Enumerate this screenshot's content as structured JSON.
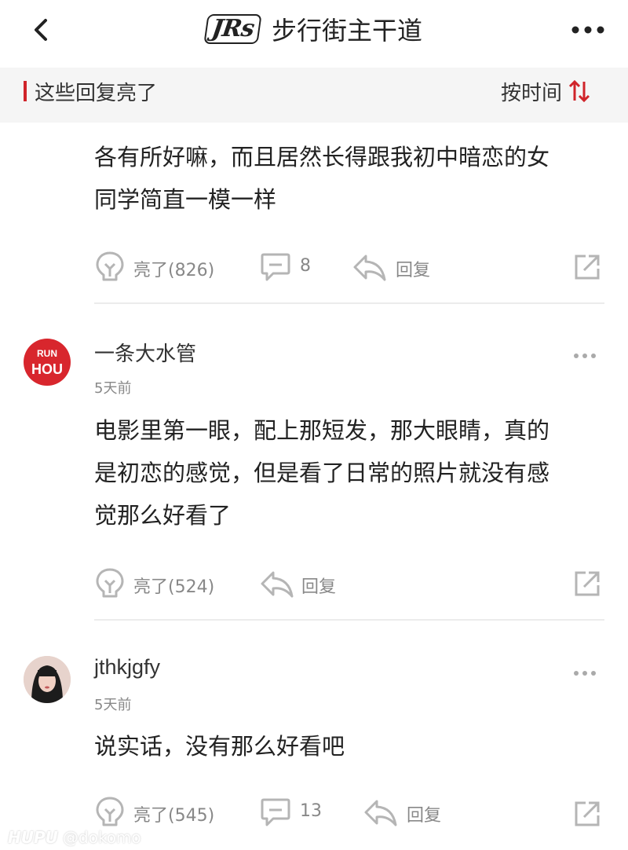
{
  "header": {
    "logo_text": "JRs",
    "title": "步行街主干道"
  },
  "subbar": {
    "title": "这些回复亮了",
    "sort_label": "按时间"
  },
  "comments": [
    {
      "text_lines": [
        "各有所好嘛，而且居然长得跟我初中暗恋的女",
        "同学简直一模一样"
      ],
      "likes": "亮了(826)",
      "reply_count": "8",
      "reply_label": "回复"
    },
    {
      "avatar_lines": [
        "RUN",
        "HOU"
      ],
      "username": "一条大水管",
      "time": "5天前",
      "text_lines": [
        "电影里第一眼，配上那短发，那大眼睛，真的",
        "是初恋的感觉，但是看了日常的照片就没有感",
        "觉那么好看了"
      ],
      "likes": "亮了(524)",
      "reply_label": "回复"
    },
    {
      "username": "jthkjgfy",
      "time": "5天前",
      "text_lines": [
        "说实话，没有那么好看吧"
      ],
      "likes": "亮了(545)",
      "reply_count": "13",
      "reply_label": "回复"
    }
  ],
  "watermark": {
    "brand": "HUPU",
    "handle": "@dokomo"
  },
  "colors": {
    "accent": "#d0242a",
    "subbar_bg": "#f5f5f5",
    "icon_gray": "#b5b5b5",
    "text_gray": "#888888"
  }
}
